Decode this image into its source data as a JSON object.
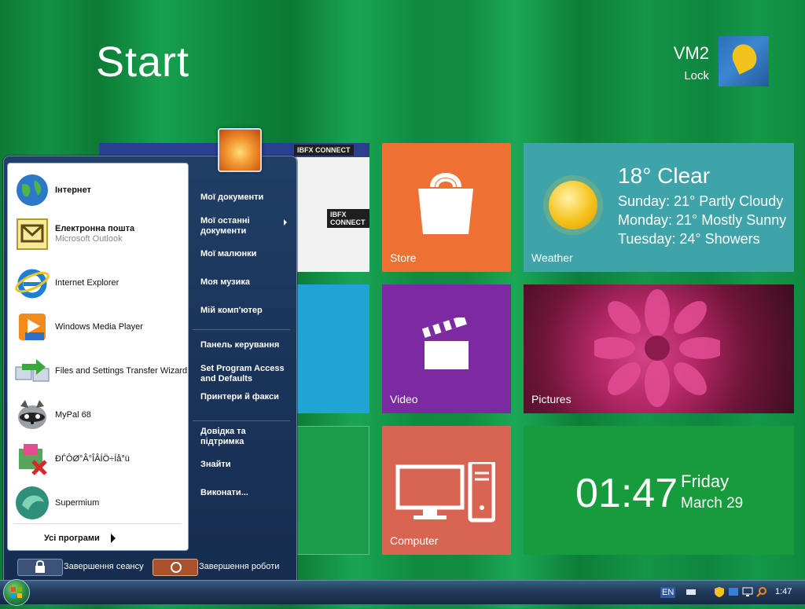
{
  "start_screen": {
    "title": "Start",
    "user_name": "VM2",
    "user_action": "Lock"
  },
  "tiles": {
    "store_label": "Store",
    "weather_label": "Weather",
    "weather_current": "18° Clear",
    "weather_forecast": [
      "Sunday: 21° Partly Cloudy",
      "Monday: 21° Mostly Sunny",
      "Tuesday: 24° Showers"
    ],
    "video_label": "Video",
    "pictures_label": "Pictures",
    "computer_label": "Computer",
    "clock_time": "01:47",
    "clock_day": "Friday",
    "clock_date": "March 29"
  },
  "news_tile": {
    "brand": "IBFX CONNECT"
  },
  "start_menu": {
    "pinned": [
      {
        "title": "Інтернет",
        "subtitle": ""
      },
      {
        "title": "Електронна пошта",
        "subtitle": "Microsoft Outlook"
      }
    ],
    "recent": [
      "Internet Explorer",
      "Windows Media Player",
      "Files and Settings Transfer Wizard",
      "MyPal 68",
      "ĐЃÔØ°Â°ÎÂÍÖ÷Íå°ü",
      "Supermium"
    ],
    "all_programs": "Усі програми",
    "right_items": [
      "Мої документи",
      "Мої останні документи",
      "Мої малюнки",
      "Моя музика",
      "Мій комп'ютер",
      "Панель керування",
      "Set Program Access and Defaults",
      "Принтери й факси",
      "Довідка та підтримка",
      "Знайти",
      "Виконати..."
    ],
    "logoff_label": "Завершення сеансу",
    "shutdown_label": "Завершення роботи"
  },
  "taskbar": {
    "language": "EN",
    "time": "1:47"
  }
}
